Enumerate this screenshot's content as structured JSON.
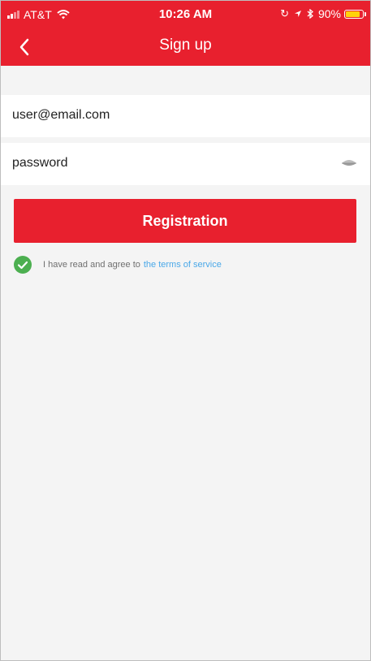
{
  "status_bar": {
    "carrier": "AT&T",
    "time": "10:26 AM",
    "battery_text": "90%",
    "battery_level": 0.9,
    "icons": [
      "signal-icon",
      "wifi-icon",
      "lock-rotation-icon",
      "location-icon",
      "bluetooth-icon",
      "battery-icon"
    ]
  },
  "header": {
    "title": "Sign up",
    "back_icon": "chevron-left-icon"
  },
  "form": {
    "email_value": "user@email.com",
    "password_value": "password",
    "password_toggle_icon": "eye-icon"
  },
  "registration_button": {
    "label": "Registration"
  },
  "agreement": {
    "text": "I have read and agree to",
    "link_text": "the terms of service",
    "checked": true
  },
  "colors": {
    "brand_red": "#e8202e",
    "link_blue": "#4aa8e8",
    "check_green": "#4caf50",
    "battery_yellow": "#ffd20a",
    "background": "#f4f4f4"
  }
}
